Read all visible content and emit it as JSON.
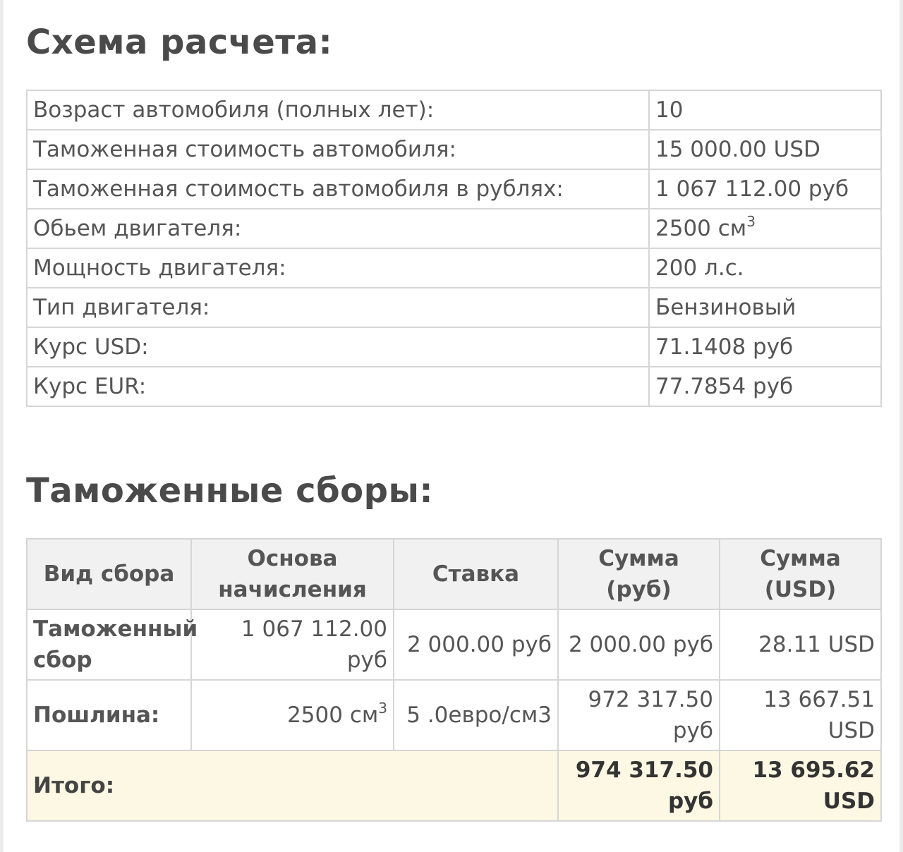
{
  "calc_scheme": {
    "title": "Схема расчета:",
    "rows": [
      {
        "label": "Возраст автомобиля (полных лет):",
        "value": "10"
      },
      {
        "label": "Таможенная стоимость автомобиля:",
        "value": "15 000.00 USD"
      },
      {
        "label": "Таможенная стоимость автомобиля в рублях:",
        "value": "1 067 112.00 руб"
      },
      {
        "label": "Обьем двигателя:",
        "value": "2500 см",
        "sup": "3"
      },
      {
        "label": "Мощность двигателя:",
        "value": "200 л.с."
      },
      {
        "label": "Тип двигателя:",
        "value": "Бензиновый"
      },
      {
        "label": "Курс USD:",
        "value": "71.1408 руб"
      },
      {
        "label": "Курс EUR:",
        "value": "77.7854 руб"
      }
    ]
  },
  "customs_fees": {
    "title": "Таможенные сборы:",
    "headers": [
      "Вид сбора",
      "Основа начисления",
      "Ставка",
      "Сумма (руб)",
      "Сумма (USD)"
    ],
    "rows": [
      {
        "type": "Таможенный сбор",
        "base": "1 067 112.00 руб",
        "rate": "2 000.00 руб",
        "sum_rub": "2 000.00 руб",
        "sum_usd": "28.11 USD"
      },
      {
        "type": "Пошлина:",
        "base": "2500 см",
        "base_sup": "3",
        "rate": "5 .0евро/см3",
        "sum_rub": "972 317.50 руб",
        "sum_usd": "13 667.51 USD"
      }
    ],
    "total": {
      "label": "Итого:",
      "sum_rub": "974 317.50 руб",
      "sum_usd": "13 695.62 USD"
    }
  }
}
